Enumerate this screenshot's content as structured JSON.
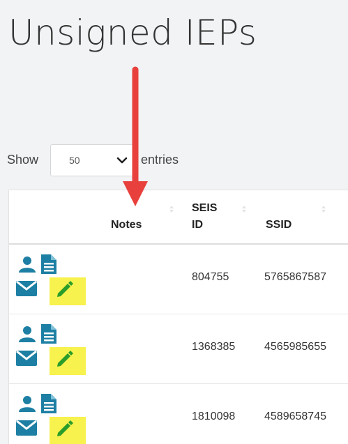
{
  "page": {
    "title": "Unsigned IEPs"
  },
  "length_control": {
    "show_label": "Show",
    "selected": "50",
    "entries_label": "entries"
  },
  "table": {
    "columns": [
      {
        "label": "Notes"
      },
      {
        "label": "SEIS\nID"
      },
      {
        "label": "SSID"
      }
    ],
    "rows": [
      {
        "seis_id": "804755",
        "ssid": "5765867587"
      },
      {
        "seis_id": "1368385",
        "ssid": "4565985655"
      },
      {
        "seis_id": "1810098",
        "ssid": "4589658745"
      }
    ],
    "row_icons": [
      "user-icon",
      "document-icon",
      "envelope-icon",
      "pencil-icon"
    ]
  },
  "annotation": {
    "type": "red-arrow",
    "points_to": "Notes",
    "color": "#e8413d"
  },
  "colors": {
    "icon_blue": "#1d7fa3",
    "highlight": "#f7f24d",
    "pencil_green": "#2a9d2a"
  }
}
